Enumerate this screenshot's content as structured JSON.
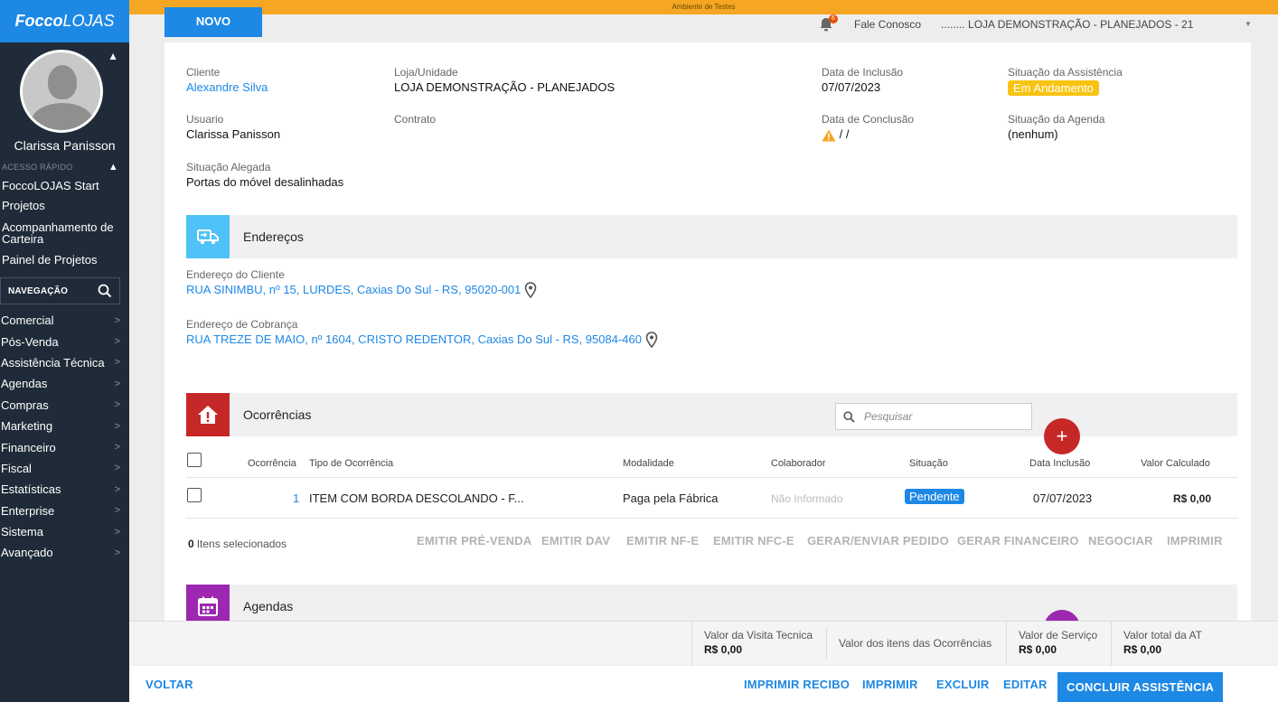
{
  "app": {
    "logo_bold": "Focco",
    "logo_rest": "LOJAS",
    "test_banner": "Ambiente de Testes",
    "new_button": "NOVO",
    "notifications_count": "6",
    "contact_link": "Fale Conosco",
    "store_selector": "........ LOJA DEMONSTRAÇÃO - PLANEJADOS - 21"
  },
  "sidebar": {
    "user_name": "Clarissa Panisson",
    "quick_access_label": "ACESSO RÁPIDO",
    "quick_items": [
      "FoccoLOJAS Start",
      "Projetos",
      "Acompanhamento de Carteira",
      "Painel de Projetos"
    ],
    "nav_label": "NAVEGAÇÃO",
    "nav_items": [
      "Comercial",
      "Pós-Venda",
      "Assistência Técnica",
      "Agendas",
      "Compras",
      "Marketing",
      "Financeiro",
      "Fiscal",
      "Estatísticas",
      "Enterprise",
      "Sistema",
      "Avançado"
    ]
  },
  "details": {
    "cliente_label": "Cliente",
    "cliente_value": "Alexandre Silva",
    "loja_label": "Loja/Unidade",
    "loja_value": "LOJA DEMONSTRAÇÃO - PLANEJADOS",
    "data_inclusao_label": "Data de Inclusão",
    "data_inclusao_value": "07/07/2023",
    "situacao_assist_label": "Situação da Assistência",
    "situacao_assist_value": "Em Andamento",
    "usuario_label": "Usuario",
    "usuario_value": "Clarissa Panisson",
    "contrato_label": "Contrato",
    "data_conclusao_label": "Data de Conclusão",
    "data_conclusao_value": "/ /",
    "situacao_agenda_label": "Situação da Agenda",
    "situacao_agenda_value": "(nenhum)",
    "situacao_alegada_label": "Situação Alegada",
    "situacao_alegada_value": "Portas do móvel desalinhadas"
  },
  "enderecos": {
    "title": "Endereços",
    "cliente_label": "Endereço do Cliente",
    "cliente_value": "RUA SINIMBU, nº 15, LURDES, Caxias Do Sul - RS, 95020-001",
    "cobranca_label": "Endereço de Cobrança",
    "cobranca_value": "RUA TREZE DE MAIO, nº 1604, CRISTO REDENTOR, Caxias Do Sul - RS, 95084-460"
  },
  "ocorrencias": {
    "title": "Ocorrências",
    "search_placeholder": "Pesquisar",
    "columns": [
      "Ocorrência",
      "Tipo de Ocorrência",
      "Modalidade",
      "Colaborador",
      "Situação",
      "Data Inclusão",
      "Valor Calculado"
    ],
    "rows": [
      {
        "ocorrencia": "1",
        "tipo": "ITEM COM BORDA DESCOLANDO - F...",
        "modalidade": "Paga pela Fábrica",
        "colaborador": "Não Informado",
        "situacao": "Pendente",
        "data": "07/07/2023",
        "valor": "R$ 0,00"
      }
    ],
    "selected_count": "0",
    "selected_label": "Itens selecionados",
    "actions": [
      "EMITIR PRÉ-VENDA",
      "EMITIR DAV",
      "EMITIR NF-E",
      "EMITIR NFC-E",
      "GERAR/ENVIAR PEDIDO",
      "GERAR FINANCEIRO",
      "NEGOCIAR",
      "IMPRIMIR"
    ]
  },
  "agendas": {
    "title": "Agendas"
  },
  "totals": {
    "visita_label": "Valor da Visita Tecnica",
    "visita_value": "R$ 0,00",
    "itens_label": "Valor dos itens das Ocorrências",
    "servico_label": "Valor de Serviço",
    "servico_value": "R$ 0,00",
    "total_label": "Valor total da AT",
    "total_value": "R$ 0,00"
  },
  "footer": {
    "back": "VOLTAR",
    "print_receipt": "IMPRIMIR RECIBO",
    "print": "IMPRIMIR",
    "delete": "EXCLUIR",
    "edit": "EDITAR",
    "conclude": "CONCLUIR ASSISTÊNCIA"
  },
  "colors": {
    "primary": "#1e88e5",
    "sidebar": "#1f2b38",
    "banner": "#f5a623",
    "status_yellow": "#f8c311",
    "ocorrencias_red": "#c62828",
    "enderecos_blue": "#4fc3f7",
    "agendas_purple": "#9c27b0"
  }
}
